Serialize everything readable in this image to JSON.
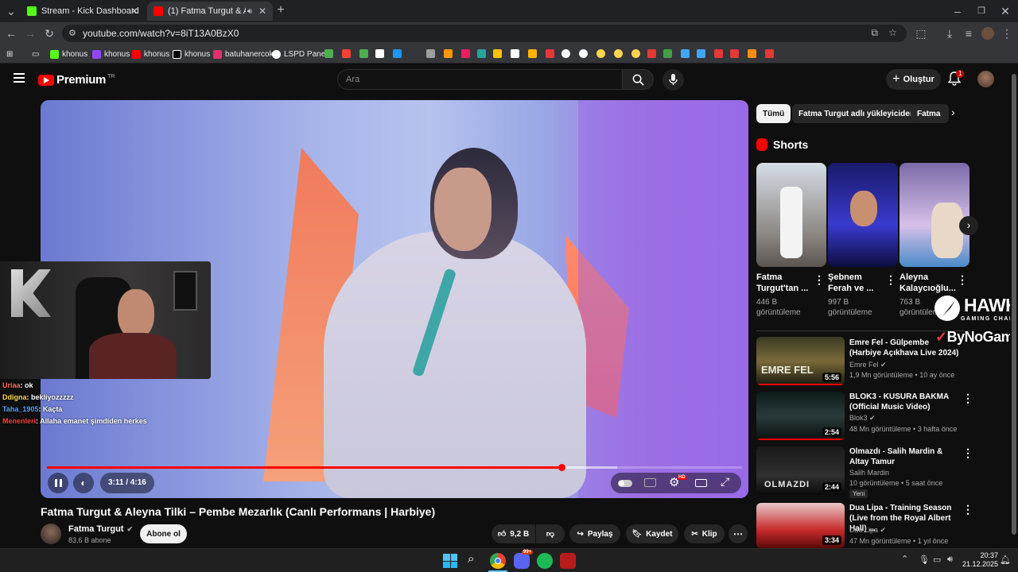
{
  "browser": {
    "tabs": [
      {
        "title": "Stream - Kick Dashboard",
        "fav_color": "#53fc18"
      },
      {
        "title": "(1) Fatma Turgut & Aleyna",
        "fav_color": "#ff0000"
      }
    ],
    "url": "youtube.com/watch?v=8iT13A0BzX0",
    "bookmarks": [
      {
        "label": "khonus",
        "color": "#53fc18"
      },
      {
        "label": "khonus",
        "color": "#9146ff"
      },
      {
        "label": "khonus",
        "color": "#ff0000"
      },
      {
        "label": "khonus",
        "color": "#ffffff"
      },
      {
        "label": "batuhanercok",
        "color": "#e1306c"
      },
      {
        "label": "LSPD Panel",
        "color": "#ffffff"
      }
    ]
  },
  "youtube": {
    "brand": "Premium",
    "brand_sup": "TR",
    "search_placeholder": "Ara",
    "create_label": "Oluştur",
    "notif_count": "1"
  },
  "player": {
    "time": "3:11 / 4:16",
    "progress": 0.74,
    "buffered": 0.82,
    "hd_badge": "HD"
  },
  "stream_overlay": {
    "chat": [
      {
        "user": "Uriaa",
        "msg": ": ok",
        "color": "#ff6b6b"
      },
      {
        "user": "Ddigna",
        "msg": ": bekliyozzzzz",
        "color": "#ffd84a"
      },
      {
        "user": "Taha_1905",
        "msg": ": Kaçta",
        "color": "#4aa3ff"
      },
      {
        "user": "Menenleri",
        "msg": ": Allaha emanet şimdiden herkes",
        "color": "#ff3b3b"
      }
    ],
    "sponsor1": "HAWK",
    "sponsor1_sub": "GAMING CHAIR",
    "sponsor2": "ByNoGame"
  },
  "video": {
    "title": "Fatma Turgut & Aleyna Tilki – Pembe Mezarlık (Canlı Performans | Harbiye)",
    "channel": "Fatma Turgut",
    "subscribers": "83,6 B abone",
    "subscribe_label": "Abone ol",
    "likes": "9,2 B",
    "share_label": "Paylaş",
    "save_label": "Kaydet",
    "clip_label": "Klip"
  },
  "filters": [
    "Tümü",
    "Fatma Turgut adlı yükleyiciden",
    "Fatma"
  ],
  "shorts": {
    "heading": "Shorts",
    "items": [
      {
        "title1": "Fatma",
        "title2": "Turgut'tan ...",
        "views1": "446 B",
        "views2": "görüntüleme"
      },
      {
        "title1": "Şebnem",
        "title2": "Ferah ve ...",
        "views1": "997 B",
        "views2": "görüntüleme"
      },
      {
        "title1": "Aleyna",
        "title2": "Kalaycıoğlu...",
        "views1": "763 B",
        "views2": "görüntüleme"
      }
    ]
  },
  "recommendations": [
    {
      "title": "Emre Fel - Gülpembe (Harbiye Açıkhava Live 2024)",
      "channel": "Emre Fel",
      "meta": "1,9 Mn görüntüleme • 10 ay önce",
      "duration": "5:56",
      "thumb_text": "EMRE FEL",
      "badge": ""
    },
    {
      "title": "BLOK3 - KUSURA BAKMA (Official Music Video)",
      "channel": "Blok3",
      "meta": "48 Mn görüntüleme • 3 hafta önce",
      "duration": "2:54",
      "thumb_text": "",
      "badge": ""
    },
    {
      "title": "Olmazdı - Salih Mardin & Altay Tamur",
      "channel": "Salih Mardin",
      "meta": "10 görüntüleme • 5 saat önce",
      "duration": "2:44",
      "thumb_text": "OLMAZDI",
      "badge": "Yeni"
    },
    {
      "title": "Dua Lipa - Training Season (Live from the Royal Albert Hall) ...",
      "channel": "Dua Lipa",
      "meta": "47 Mn görüntüleme • 1 yıl önce",
      "duration": "3:34",
      "thumb_text": "",
      "badge": ""
    }
  ],
  "taskbar": {
    "time": "20:37",
    "date": "21.12.2025",
    "discord_badge": "99+"
  }
}
